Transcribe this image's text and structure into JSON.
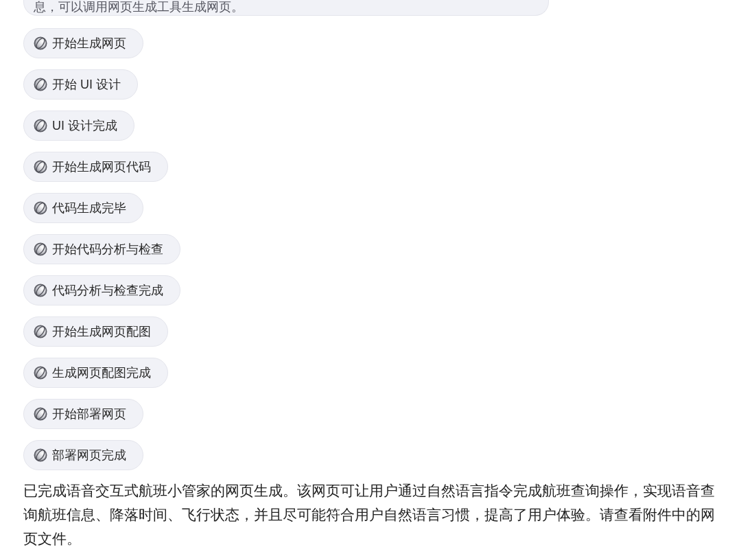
{
  "message_box": {
    "text": "息，可以调用网页生成工具生成网页。"
  },
  "steps": [
    {
      "label": "开始生成网页"
    },
    {
      "label": "开始 UI 设计"
    },
    {
      "label": "UI 设计完成"
    },
    {
      "label": "开始生成网页代码"
    },
    {
      "label": "代码生成完毕"
    },
    {
      "label": "开始代码分析与检查"
    },
    {
      "label": "代码分析与检查完成"
    },
    {
      "label": "开始生成网页配图"
    },
    {
      "label": "生成网页配图完成"
    },
    {
      "label": "开始部署网页"
    },
    {
      "label": "部署网页完成"
    }
  ],
  "summary": "已完成语音交互式航班小管家的网页生成。该网页可让用户通过自然语言指令完成航班查询操作，实现语音查询航班信息、降落时间、飞行状态，并且尽可能符合用户自然语言习惯，提高了用户体验。请查看附件中的网页文件。"
}
